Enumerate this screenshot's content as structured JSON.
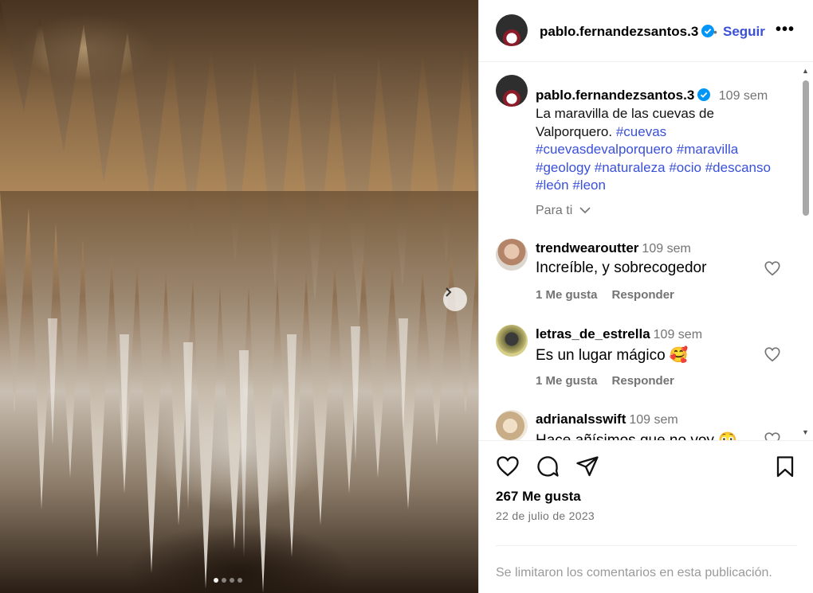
{
  "post": {
    "username": "pablo.fernandezsantos.3",
    "follow_label": "Seguir",
    "separator": "•",
    "more_label": "•••",
    "time_ago": "109 sem",
    "caption_text": "La maravilla de las cuevas de Valporquero.",
    "hashtags": [
      "#cuevas",
      "#cuevasdevalporquero",
      "#maravilla",
      "#geology",
      "#naturaleza",
      "#ocio",
      "#descanso",
      "#león",
      "#leon"
    ],
    "translate_hint": "Para ti"
  },
  "comments": [
    {
      "username": "trendwearoutter",
      "time": "109 sem",
      "text": "Increíble, y sobrecogedor",
      "likes": "1 Me gusta",
      "reply": "Responder"
    },
    {
      "username": "letras_de_estrella",
      "time": "109 sem",
      "text": "Es un lugar mágico 🥰",
      "likes": "1 Me gusta",
      "reply": "Responder"
    },
    {
      "username": "adrianalsswift",
      "time": "109 sem",
      "text": "Hace añísimos que no voy 😳",
      "likes": "",
      "reply": ""
    }
  ],
  "stats": {
    "likes": "267 Me gusta",
    "date": "22 de julio de 2023"
  },
  "footer": {
    "comments_disabled": "Se limitaron los comentarios en esta publicación."
  },
  "carousel": {
    "total": 4,
    "active_index": 0
  },
  "colors": {
    "link": "#3a50d9",
    "verified": "#0095f6",
    "muted": "#737373"
  }
}
